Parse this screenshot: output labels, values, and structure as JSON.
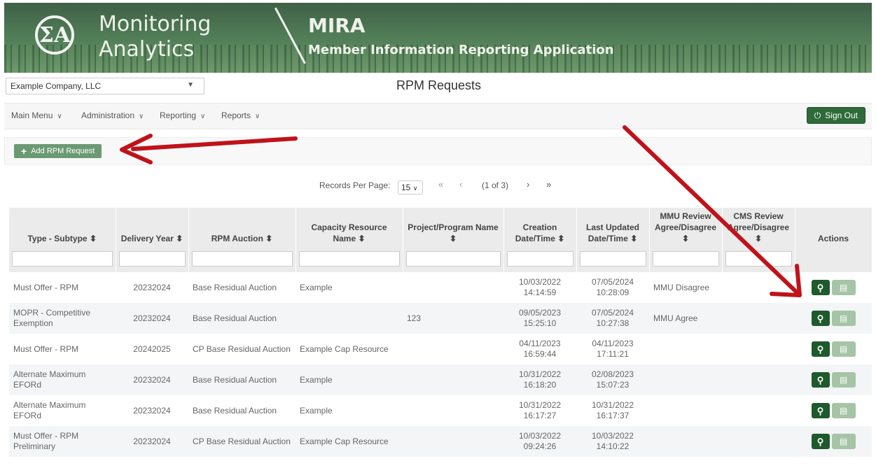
{
  "banner": {
    "logo_glyph": "ΣA",
    "brand_line1": "Monitoring",
    "brand_line2": "Analytics",
    "app_name": "MIRA",
    "app_subtitle": "Member Information Reporting Application"
  },
  "company_select": {
    "value": "Example Company, LLC"
  },
  "page_title": "RPM Requests",
  "menu": {
    "items": [
      "Main Menu",
      "Administration",
      "Reporting",
      "Reports"
    ],
    "sign_out": "Sign Out"
  },
  "toolbar": {
    "add_label": "Add RPM Request"
  },
  "pager": {
    "records_label": "Records Per Page:",
    "records_value": "15",
    "page_info": "(1 of 3)",
    "first": "«",
    "prev": "‹",
    "next": "›",
    "last": "»"
  },
  "table": {
    "headers": [
      "Type - Subtype ⬍",
      "Delivery Year ⬍",
      "RPM Auction ⬍",
      "Capacity Resource Name ⬍",
      "Project/Program Name ⬍",
      "Creation Date/Time ⬍",
      "Last Updated Date/Time ⬍",
      "MMU Review Agree/Disagree ⬍",
      "CMS Review Agree/Disagree ⬍",
      "Actions"
    ],
    "rows": [
      {
        "type": "Must Offer - RPM",
        "year": "20232024",
        "auction": "Base Residual Auction",
        "resource": "Example",
        "project": "",
        "created_date": "10/03/2022",
        "created_time": "14:14:59",
        "updated_date": "07/05/2024",
        "updated_time": "10:28:09",
        "mmu": "MMU Disagree",
        "cms": ""
      },
      {
        "type": "MOPR - Competitive Exemption",
        "year": "20232024",
        "auction": "Base Residual Auction",
        "resource": "",
        "project": "123",
        "created_date": "09/05/2023",
        "created_time": "15:25:10",
        "updated_date": "07/05/2024",
        "updated_time": "10:27:38",
        "mmu": "MMU Agree",
        "cms": ""
      },
      {
        "type": "Must Offer - RPM",
        "year": "20242025",
        "auction": "CP Base Residual Auction",
        "resource": "Example Cap Resource",
        "project": "",
        "created_date": "04/11/2023",
        "created_time": "16:59:44",
        "updated_date": "04/11/2023",
        "updated_time": "17:11:21",
        "mmu": "",
        "cms": ""
      },
      {
        "type": "Alternate Maximum EFORd",
        "year": "20232024",
        "auction": "Base Residual Auction",
        "resource": "Example",
        "project": "",
        "created_date": "10/31/2022",
        "created_time": "16:18:20",
        "updated_date": "02/08/2023",
        "updated_time": "15:07:23",
        "mmu": "",
        "cms": ""
      },
      {
        "type": "Alternate Maximum EFORd",
        "year": "20232024",
        "auction": "Base Residual Auction",
        "resource": "Example",
        "project": "",
        "created_date": "10/31/2022",
        "created_time": "16:17:27",
        "updated_date": "10/31/2022",
        "updated_time": "16:17:37",
        "mmu": "",
        "cms": ""
      },
      {
        "type": "Must Offer - RPM Preliminary",
        "year": "20232024",
        "auction": "CP Base Residual Auction",
        "resource": "Example Cap Resource",
        "project": "",
        "created_date": "10/03/2022",
        "created_time": "09:24:26",
        "updated_date": "10/03/2022",
        "updated_time": "14:10:22",
        "mmu": "",
        "cms": ""
      }
    ]
  },
  "colors": {
    "banner_green": "#4f7b56",
    "action_green": "#1f5a2c",
    "arrow_red": "#c0121a"
  },
  "icons": [
    "power-icon",
    "plus-icon",
    "search-icon",
    "trash-icon",
    "chevron-down-icon",
    "sort-icon"
  ]
}
